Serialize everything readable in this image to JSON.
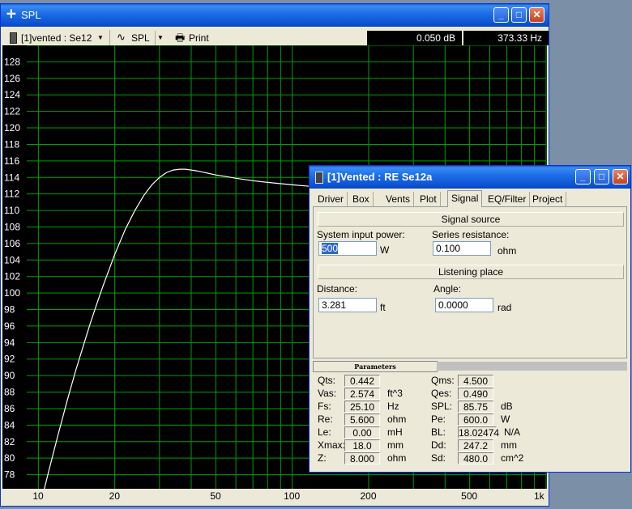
{
  "spl_window": {
    "title": "SPL",
    "toolbar": {
      "project_select": "[1]vented : Se12",
      "curve_select": "SPL",
      "print_label": "Print",
      "readout_db": "0.050 dB",
      "readout_hz": "373.33 Hz"
    },
    "window_buttons": {
      "minimize": "_",
      "maximize": "□",
      "close": "✕"
    }
  },
  "chart_data": {
    "type": "line",
    "title": "",
    "xlabel": "",
    "ylabel": "",
    "x_scale": "log",
    "xlim": [
      9,
      1000
    ],
    "ylim": [
      76,
      130
    ],
    "grid": true,
    "x_tick_labels": [
      "10",
      "20",
      "50",
      "100",
      "200",
      "500",
      "1k"
    ],
    "x_tick_values": [
      10,
      20,
      50,
      100,
      200,
      500,
      1000
    ],
    "y_tick_labels": [
      "128",
      "126",
      "124",
      "122",
      "120",
      "118",
      "116",
      "114",
      "112",
      "110",
      "108",
      "106",
      "104",
      "102",
      "100",
      "98",
      "96",
      "94",
      "92",
      "90",
      "88",
      "86",
      "84",
      "82",
      "80",
      "78"
    ],
    "y_tick_values": [
      128,
      126,
      124,
      122,
      120,
      118,
      116,
      114,
      112,
      110,
      108,
      106,
      104,
      102,
      100,
      98,
      96,
      94,
      92,
      90,
      88,
      86,
      84,
      82,
      80,
      78
    ],
    "series": [
      {
        "x": [
          10.5,
          11,
          12,
          13,
          14,
          15,
          16,
          17,
          18,
          20,
          22,
          24,
          26,
          28,
          30,
          32,
          34,
          36,
          38,
          40,
          42,
          45,
          50,
          55,
          60,
          70,
          80,
          100,
          120,
          140,
          170,
          200,
          250,
          300,
          400,
          500,
          700,
          1000
        ],
        "y": [
          76,
          78.5,
          83,
          87,
          90.5,
          93.5,
          96.3,
          98.7,
          100.9,
          104.7,
          107.7,
          110.0,
          111.8,
          113.1,
          114.0,
          114.6,
          114.9,
          115.0,
          115.0,
          114.9,
          114.8,
          114.6,
          114.3,
          114.1,
          113.9,
          113.6,
          113.4,
          113.1,
          112.9,
          112.8,
          112.6,
          112.5,
          112.4,
          112.3,
          112.2,
          112.1,
          112.0,
          112.0
        ]
      }
    ],
    "colors": {
      "background": "#000000",
      "grid": "#00a000",
      "line": "#ffffff"
    }
  },
  "dialog": {
    "title": "[1]Vented : RE Se12a",
    "tabs": [
      "Driver",
      "Box",
      "Vents",
      "Plot",
      "Signal",
      "EQ/Filter",
      "Project"
    ],
    "active_tab": "Signal",
    "signal_source": {
      "heading": "Signal source",
      "input_power_label": "System input power:",
      "input_power_value": "500",
      "input_power_unit": "W",
      "series_resistance_label": "Series resistance:",
      "series_resistance_value": "0.100",
      "series_resistance_unit": "ohm"
    },
    "listening_place": {
      "heading": "Listening place",
      "distance_label": "Distance:",
      "distance_value": "3.281",
      "distance_unit": "ft",
      "angle_label": "Angle:",
      "angle_value": "0.0000",
      "angle_unit": "rad"
    },
    "parameters_tab": "Parameters",
    "params_left": [
      {
        "label": "Qts:",
        "value": "0.442",
        "unit": ""
      },
      {
        "label": "Vas:",
        "value": "2.574",
        "unit": "ft^3"
      },
      {
        "label": "Fs:",
        "value": "25.10",
        "unit": "Hz"
      },
      {
        "label": "Re:",
        "value": "5.600",
        "unit": "ohm"
      },
      {
        "label": "Le:",
        "value": "0.00",
        "unit": "mH"
      },
      {
        "label": "Xmax:",
        "value": "18.0",
        "unit": "mm"
      },
      {
        "label": "Z:",
        "value": "8.000",
        "unit": "ohm"
      }
    ],
    "params_right": [
      {
        "label": "Qms:",
        "value": "4.500",
        "unit": ""
      },
      {
        "label": "Qes:",
        "value": "0.490",
        "unit": ""
      },
      {
        "label": "SPL:",
        "value": "85.75",
        "unit": "dB"
      },
      {
        "label": "Pe:",
        "value": "600.0",
        "unit": "W"
      },
      {
        "label": "BL:",
        "value": "18.02474",
        "unit": "N/A"
      },
      {
        "label": "Dd:",
        "value": "247.2",
        "unit": "mm"
      },
      {
        "label": "Sd:",
        "value": "480.0",
        "unit": "cm^2"
      }
    ]
  }
}
